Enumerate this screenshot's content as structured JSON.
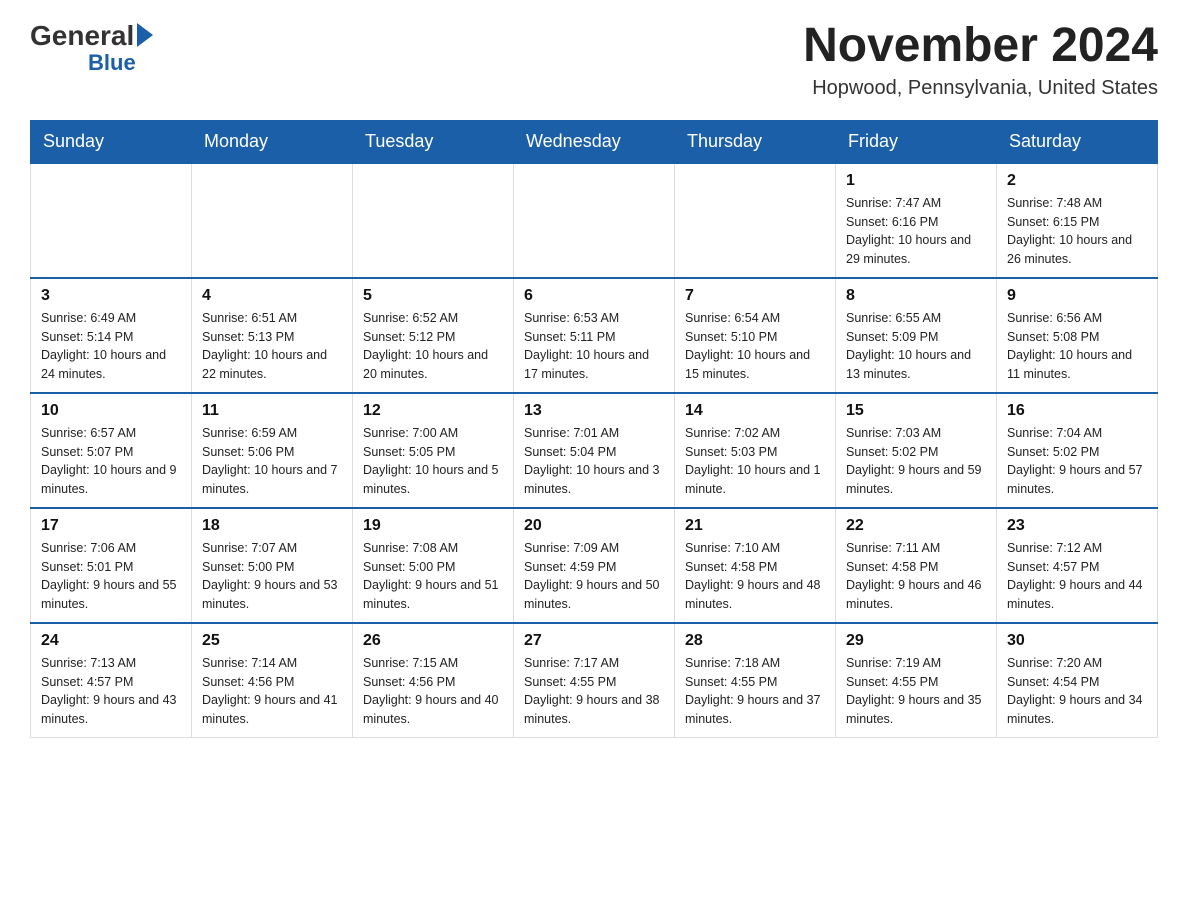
{
  "header": {
    "logo_general": "General",
    "logo_blue": "Blue",
    "month_title": "November 2024",
    "location": "Hopwood, Pennsylvania, United States"
  },
  "weekdays": [
    "Sunday",
    "Monday",
    "Tuesday",
    "Wednesday",
    "Thursday",
    "Friday",
    "Saturday"
  ],
  "weeks": [
    [
      {
        "day": "",
        "info": ""
      },
      {
        "day": "",
        "info": ""
      },
      {
        "day": "",
        "info": ""
      },
      {
        "day": "",
        "info": ""
      },
      {
        "day": "",
        "info": ""
      },
      {
        "day": "1",
        "info": "Sunrise: 7:47 AM\nSunset: 6:16 PM\nDaylight: 10 hours and 29 minutes."
      },
      {
        "day": "2",
        "info": "Sunrise: 7:48 AM\nSunset: 6:15 PM\nDaylight: 10 hours and 26 minutes."
      }
    ],
    [
      {
        "day": "3",
        "info": "Sunrise: 6:49 AM\nSunset: 5:14 PM\nDaylight: 10 hours and 24 minutes."
      },
      {
        "day": "4",
        "info": "Sunrise: 6:51 AM\nSunset: 5:13 PM\nDaylight: 10 hours and 22 minutes."
      },
      {
        "day": "5",
        "info": "Sunrise: 6:52 AM\nSunset: 5:12 PM\nDaylight: 10 hours and 20 minutes."
      },
      {
        "day": "6",
        "info": "Sunrise: 6:53 AM\nSunset: 5:11 PM\nDaylight: 10 hours and 17 minutes."
      },
      {
        "day": "7",
        "info": "Sunrise: 6:54 AM\nSunset: 5:10 PM\nDaylight: 10 hours and 15 minutes."
      },
      {
        "day": "8",
        "info": "Sunrise: 6:55 AM\nSunset: 5:09 PM\nDaylight: 10 hours and 13 minutes."
      },
      {
        "day": "9",
        "info": "Sunrise: 6:56 AM\nSunset: 5:08 PM\nDaylight: 10 hours and 11 minutes."
      }
    ],
    [
      {
        "day": "10",
        "info": "Sunrise: 6:57 AM\nSunset: 5:07 PM\nDaylight: 10 hours and 9 minutes."
      },
      {
        "day": "11",
        "info": "Sunrise: 6:59 AM\nSunset: 5:06 PM\nDaylight: 10 hours and 7 minutes."
      },
      {
        "day": "12",
        "info": "Sunrise: 7:00 AM\nSunset: 5:05 PM\nDaylight: 10 hours and 5 minutes."
      },
      {
        "day": "13",
        "info": "Sunrise: 7:01 AM\nSunset: 5:04 PM\nDaylight: 10 hours and 3 minutes."
      },
      {
        "day": "14",
        "info": "Sunrise: 7:02 AM\nSunset: 5:03 PM\nDaylight: 10 hours and 1 minute."
      },
      {
        "day": "15",
        "info": "Sunrise: 7:03 AM\nSunset: 5:02 PM\nDaylight: 9 hours and 59 minutes."
      },
      {
        "day": "16",
        "info": "Sunrise: 7:04 AM\nSunset: 5:02 PM\nDaylight: 9 hours and 57 minutes."
      }
    ],
    [
      {
        "day": "17",
        "info": "Sunrise: 7:06 AM\nSunset: 5:01 PM\nDaylight: 9 hours and 55 minutes."
      },
      {
        "day": "18",
        "info": "Sunrise: 7:07 AM\nSunset: 5:00 PM\nDaylight: 9 hours and 53 minutes."
      },
      {
        "day": "19",
        "info": "Sunrise: 7:08 AM\nSunset: 5:00 PM\nDaylight: 9 hours and 51 minutes."
      },
      {
        "day": "20",
        "info": "Sunrise: 7:09 AM\nSunset: 4:59 PM\nDaylight: 9 hours and 50 minutes."
      },
      {
        "day": "21",
        "info": "Sunrise: 7:10 AM\nSunset: 4:58 PM\nDaylight: 9 hours and 48 minutes."
      },
      {
        "day": "22",
        "info": "Sunrise: 7:11 AM\nSunset: 4:58 PM\nDaylight: 9 hours and 46 minutes."
      },
      {
        "day": "23",
        "info": "Sunrise: 7:12 AM\nSunset: 4:57 PM\nDaylight: 9 hours and 44 minutes."
      }
    ],
    [
      {
        "day": "24",
        "info": "Sunrise: 7:13 AM\nSunset: 4:57 PM\nDaylight: 9 hours and 43 minutes."
      },
      {
        "day": "25",
        "info": "Sunrise: 7:14 AM\nSunset: 4:56 PM\nDaylight: 9 hours and 41 minutes."
      },
      {
        "day": "26",
        "info": "Sunrise: 7:15 AM\nSunset: 4:56 PM\nDaylight: 9 hours and 40 minutes."
      },
      {
        "day": "27",
        "info": "Sunrise: 7:17 AM\nSunset: 4:55 PM\nDaylight: 9 hours and 38 minutes."
      },
      {
        "day": "28",
        "info": "Sunrise: 7:18 AM\nSunset: 4:55 PM\nDaylight: 9 hours and 37 minutes."
      },
      {
        "day": "29",
        "info": "Sunrise: 7:19 AM\nSunset: 4:55 PM\nDaylight: 9 hours and 35 minutes."
      },
      {
        "day": "30",
        "info": "Sunrise: 7:20 AM\nSunset: 4:54 PM\nDaylight: 9 hours and 34 minutes."
      }
    ]
  ]
}
